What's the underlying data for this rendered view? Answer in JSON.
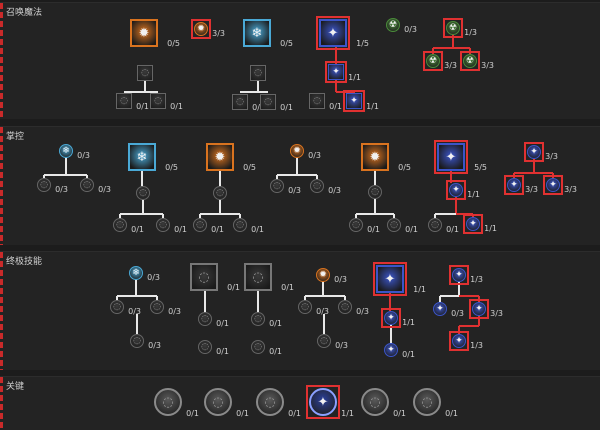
{
  "colors": {
    "active_outline": "#e03131",
    "connector": "#e8e8e8",
    "fire": "#d9731f",
    "frost": "#4aa9d6",
    "shock": "#3b55c9",
    "poison": "#4a8c3a",
    "inactive": "#5a5a5a"
  },
  "sections": [
    {
      "key": "summon",
      "title": "召唤魔法"
    },
    {
      "key": "control",
      "title": "掌控"
    },
    {
      "key": "ultimate",
      "title": "终极技能"
    },
    {
      "key": "key",
      "title": "关键"
    }
  ],
  "nodes": [
    {
      "id": "s1",
      "kind": "big",
      "element": "fire",
      "active": false,
      "rank": "0/5",
      "icon": "skeleton-mage-icon"
    },
    {
      "id": "s1a",
      "kind": "med",
      "element": "inactive",
      "active": false,
      "rank": "",
      "icon": "skeleton-mage-upgrade-icon"
    },
    {
      "id": "s1b",
      "kind": "med",
      "element": "inactive",
      "active": false,
      "rank": "0/1",
      "icon": "skeleton-mage-fire-icon"
    },
    {
      "id": "s1c",
      "kind": "med",
      "element": "inactive",
      "active": false,
      "rank": "0/1",
      "icon": "skeleton-mage-cold-icon"
    },
    {
      "id": "s2",
      "kind": "small",
      "element": "fire",
      "active": true,
      "rank": "3/3",
      "icon": "summon-passive-icon"
    },
    {
      "id": "s3",
      "kind": "big",
      "element": "frost",
      "active": false,
      "rank": "0/5",
      "icon": "golem-icon"
    },
    {
      "id": "s3a",
      "kind": "med",
      "element": "inactive",
      "active": false,
      "rank": "",
      "icon": "golem-upgrade-icon"
    },
    {
      "id": "s3b",
      "kind": "med",
      "element": "inactive",
      "active": false,
      "rank": "0/1",
      "icon": "golem-iron-icon"
    },
    {
      "id": "s3c",
      "kind": "med",
      "element": "inactive",
      "active": false,
      "rank": "0/1",
      "icon": "golem-blood-icon"
    },
    {
      "id": "s4",
      "kind": "big",
      "element": "shock",
      "active": true,
      "rank": "1/5",
      "icon": "summon-spirit-icon"
    },
    {
      "id": "s4a",
      "kind": "med",
      "element": "shock",
      "active": true,
      "rank": "1/1",
      "icon": "summon-spirit-upgrade-icon"
    },
    {
      "id": "s4b",
      "kind": "med",
      "element": "shock",
      "active": true,
      "rank": "1/1",
      "icon": "summon-spirit-shock-icon"
    },
    {
      "id": "s4c",
      "kind": "med",
      "element": "inactive",
      "active": false,
      "rank": "0/1",
      "icon": "summon-spirit-alt-icon"
    },
    {
      "id": "s5",
      "kind": "small",
      "element": "poison",
      "active": false,
      "rank": "0/3",
      "icon": "poison-passive-icon"
    },
    {
      "id": "s6",
      "kind": "small",
      "element": "poison",
      "active": true,
      "rank": "1/3",
      "icon": "summon-mastery-icon"
    },
    {
      "id": "s6a",
      "kind": "small",
      "element": "poison",
      "active": true,
      "rank": "3/3",
      "icon": "summon-mastery-a-icon"
    },
    {
      "id": "s6b",
      "kind": "small",
      "element": "poison",
      "active": true,
      "rank": "3/3",
      "icon": "summon-mastery-b-icon"
    },
    {
      "id": "c1",
      "kind": "small",
      "element": "frost",
      "active": false,
      "rank": "0/3",
      "icon": "frost-passive-icon"
    },
    {
      "id": "c1a",
      "kind": "small",
      "element": "inactive",
      "active": false,
      "rank": "0/3",
      "icon": "frost-passive-a-icon"
    },
    {
      "id": "c1b",
      "kind": "small",
      "element": "inactive",
      "active": false,
      "rank": "0/3",
      "icon": "frost-passive-b-icon"
    },
    {
      "id": "c2",
      "kind": "big",
      "element": "frost",
      "active": false,
      "rank": "0/5",
      "icon": "frost-nova-icon"
    },
    {
      "id": "c2a",
      "kind": "small",
      "element": "inactive",
      "active": false,
      "rank": "",
      "icon": "frost-nova-upgrade-icon"
    },
    {
      "id": "c2b",
      "kind": "small",
      "element": "inactive",
      "active": false,
      "rank": "0/1",
      "icon": "frost-nova-a-icon"
    },
    {
      "id": "c2c",
      "kind": "small",
      "element": "inactive",
      "active": false,
      "rank": "0/1",
      "icon": "frost-nova-b-icon"
    },
    {
      "id": "c3",
      "kind": "big",
      "element": "fire",
      "active": false,
      "rank": "0/5",
      "icon": "fire-wall-icon"
    },
    {
      "id": "c3a",
      "kind": "small",
      "element": "inactive",
      "active": false,
      "rank": "",
      "icon": "fire-wall-upgrade-icon"
    },
    {
      "id": "c3b",
      "kind": "small",
      "element": "inactive",
      "active": false,
      "rank": "0/1",
      "icon": "fire-wall-a-icon"
    },
    {
      "id": "c3c",
      "kind": "small",
      "element": "inactive",
      "active": false,
      "rank": "0/1",
      "icon": "fire-wall-b-icon"
    },
    {
      "id": "c4",
      "kind": "small",
      "element": "fire",
      "active": false,
      "rank": "0/3",
      "icon": "fire-passive-icon"
    },
    {
      "id": "c4a",
      "kind": "small",
      "element": "inactive",
      "active": false,
      "rank": "0/3",
      "icon": "fire-passive-a-icon"
    },
    {
      "id": "c4b",
      "kind": "small",
      "element": "inactive",
      "active": false,
      "rank": "0/3",
      "icon": "fire-passive-b-icon"
    },
    {
      "id": "c5",
      "kind": "big",
      "element": "fire",
      "active": false,
      "rank": "0/5",
      "icon": "flame-crown-icon"
    },
    {
      "id": "c5a",
      "kind": "small",
      "element": "inactive",
      "active": false,
      "rank": "",
      "icon": "flame-crown-upgrade-icon"
    },
    {
      "id": "c5b",
      "kind": "small",
      "element": "inactive",
      "active": false,
      "rank": "0/1",
      "icon": "flame-crown-a-icon"
    },
    {
      "id": "c5c",
      "kind": "small",
      "element": "inactive",
      "active": false,
      "rank": "0/1",
      "icon": "flame-crown-b-icon"
    },
    {
      "id": "c6",
      "kind": "big",
      "element": "shock",
      "active": true,
      "rank": "5/5",
      "icon": "vortex-icon"
    },
    {
      "id": "c6a",
      "kind": "small",
      "element": "shock",
      "active": true,
      "rank": "1/1",
      "icon": "vortex-upgrade-icon"
    },
    {
      "id": "c6b",
      "kind": "small",
      "element": "shock",
      "active": true,
      "rank": "1/1",
      "icon": "vortex-shock-icon"
    },
    {
      "id": "c6c",
      "kind": "small",
      "element": "inactive",
      "active": false,
      "rank": "0/1",
      "icon": "vortex-alt-icon"
    },
    {
      "id": "c7",
      "kind": "small",
      "element": "shock",
      "active": true,
      "rank": "3/3",
      "icon": "shock-passive-icon"
    },
    {
      "id": "c7a",
      "kind": "small",
      "element": "shock",
      "active": true,
      "rank": "3/3",
      "icon": "shock-passive-a-icon"
    },
    {
      "id": "c7b",
      "kind": "small",
      "element": "shock",
      "active": true,
      "rank": "3/3",
      "icon": "shock-passive-b-icon"
    },
    {
      "id": "u1",
      "kind": "small",
      "element": "frost",
      "active": false,
      "rank": "0/3",
      "icon": "ult-frost-passive-icon"
    },
    {
      "id": "u1a",
      "kind": "small",
      "element": "inactive",
      "active": false,
      "rank": "0/3",
      "icon": "ult-frost-a-icon"
    },
    {
      "id": "u1b",
      "kind": "small",
      "element": "inactive",
      "active": false,
      "rank": "0/3",
      "icon": "ult-frost-b-icon"
    },
    {
      "id": "u1c",
      "kind": "small",
      "element": "inactive",
      "active": false,
      "rank": "0/3",
      "icon": "ult-frost-c-icon"
    },
    {
      "id": "u2",
      "kind": "big",
      "element": "inactive",
      "active": false,
      "rank": "0/1",
      "icon": "ult-tower-icon"
    },
    {
      "id": "u2a",
      "kind": "small",
      "element": "inactive",
      "active": false,
      "rank": "0/1",
      "icon": "ult-tower-a-icon"
    },
    {
      "id": "u2b",
      "kind": "small",
      "element": "inactive",
      "active": false,
      "rank": "0/1",
      "icon": "ult-tower-b-icon"
    },
    {
      "id": "u3",
      "kind": "big",
      "element": "inactive",
      "active": false,
      "rank": "0/1",
      "icon": "ult-skull-icon"
    },
    {
      "id": "u3a",
      "kind": "small",
      "element": "inactive",
      "active": false,
      "rank": "0/1",
      "icon": "ult-skull-a-icon"
    },
    {
      "id": "u3b",
      "kind": "small",
      "element": "inactive",
      "active": false,
      "rank": "0/1",
      "icon": "ult-skull-b-icon"
    },
    {
      "id": "u4",
      "kind": "small",
      "element": "fire",
      "active": false,
      "rank": "0/3",
      "icon": "ult-fire-passive-icon"
    },
    {
      "id": "u4a",
      "kind": "small",
      "element": "inactive",
      "active": false,
      "rank": "0/3",
      "icon": "ult-fire-a-icon"
    },
    {
      "id": "u4b",
      "kind": "small",
      "element": "inactive",
      "active": false,
      "rank": "0/3",
      "icon": "ult-fire-b-icon"
    },
    {
      "id": "u4c",
      "kind": "small",
      "element": "inactive",
      "active": false,
      "rank": "0/3",
      "icon": "ult-fire-c-icon"
    },
    {
      "id": "u5",
      "kind": "big",
      "element": "shock",
      "active": true,
      "rank": "1/1",
      "icon": "ult-dragon-icon"
    },
    {
      "id": "u5a",
      "kind": "small",
      "element": "shock",
      "active": true,
      "rank": "1/1",
      "icon": "ult-dragon-upgrade-icon"
    },
    {
      "id": "u5b",
      "kind": "small",
      "element": "shock",
      "active": false,
      "rank": "0/1",
      "icon": "ult-dragon-alt-icon"
    },
    {
      "id": "u6",
      "kind": "small",
      "element": "shock",
      "active": true,
      "rank": "1/3",
      "icon": "ult-shock-passive-icon"
    },
    {
      "id": "u6a",
      "kind": "small",
      "element": "shock",
      "active": false,
      "rank": "0/3",
      "icon": "ult-shock-a-icon"
    },
    {
      "id": "u6b",
      "kind": "small",
      "element": "shock",
      "active": true,
      "rank": "3/3",
      "icon": "ult-shock-b-icon"
    },
    {
      "id": "u6c",
      "kind": "small",
      "element": "shock",
      "active": true,
      "rank": "1/3",
      "icon": "ult-shock-c-icon"
    },
    {
      "id": "k1",
      "kind": "key",
      "element": "inactive",
      "active": false,
      "rank": "0/1",
      "icon": "key-swirl-icon"
    },
    {
      "id": "k2",
      "kind": "key",
      "element": "inactive",
      "active": false,
      "rank": "0/1",
      "icon": "key-snowflake-icon"
    },
    {
      "id": "k3",
      "kind": "key",
      "element": "inactive",
      "active": false,
      "rank": "0/1",
      "icon": "key-shard-icon"
    },
    {
      "id": "k4",
      "kind": "key",
      "element": "shock",
      "active": true,
      "rank": "1/1",
      "icon": "key-shock-icon"
    },
    {
      "id": "k5",
      "kind": "key",
      "element": "inactive",
      "active": false,
      "rank": "0/1",
      "icon": "key-crown-icon"
    },
    {
      "id": "k6",
      "kind": "key",
      "element": "inactive",
      "active": false,
      "rank": "0/1",
      "icon": "key-flame-icon"
    }
  ]
}
